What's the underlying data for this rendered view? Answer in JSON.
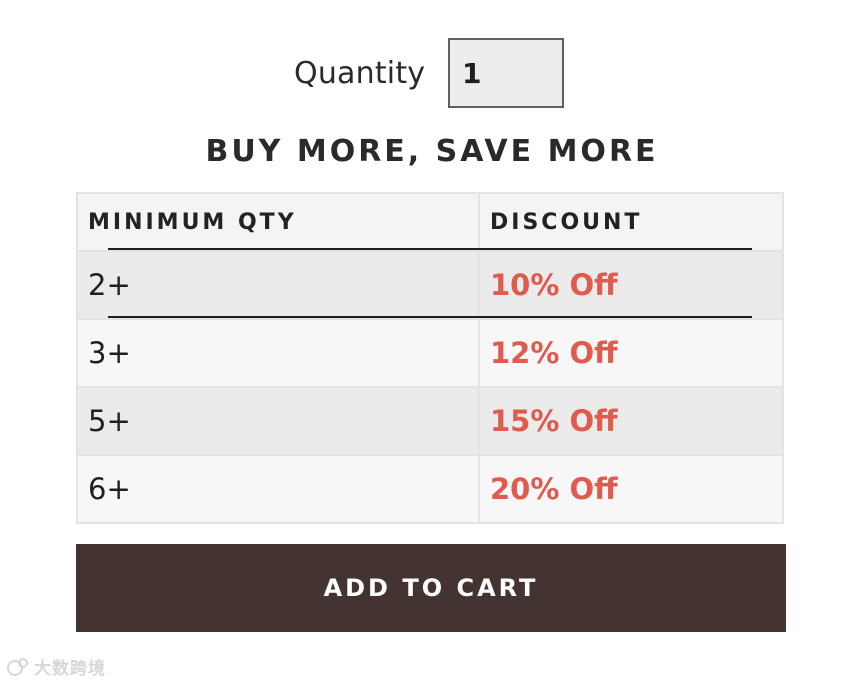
{
  "quantity": {
    "label": "Quantity",
    "value": "1"
  },
  "promo": {
    "title": "BUY MORE, SAVE MORE"
  },
  "tiers": {
    "headers": {
      "min_qty": "MINIMUM QTY",
      "discount": "DISCOUNT"
    },
    "rows": [
      {
        "min_qty": "2+",
        "discount": "10% Off"
      },
      {
        "min_qty": "3+",
        "discount": "12% Off"
      },
      {
        "min_qty": "5+",
        "discount": "15% Off"
      },
      {
        "min_qty": "6+",
        "discount": "20% Off"
      }
    ]
  },
  "cart": {
    "button_label": "ADD TO CART"
  },
  "watermark": {
    "text": "大数跨境",
    "icon": "brand-logo-icon"
  },
  "colors": {
    "discount_text": "#e05a4d",
    "cart_button": "#433431",
    "row_shaded": "#ebebeb",
    "row_plain": "#f7f7f7"
  }
}
